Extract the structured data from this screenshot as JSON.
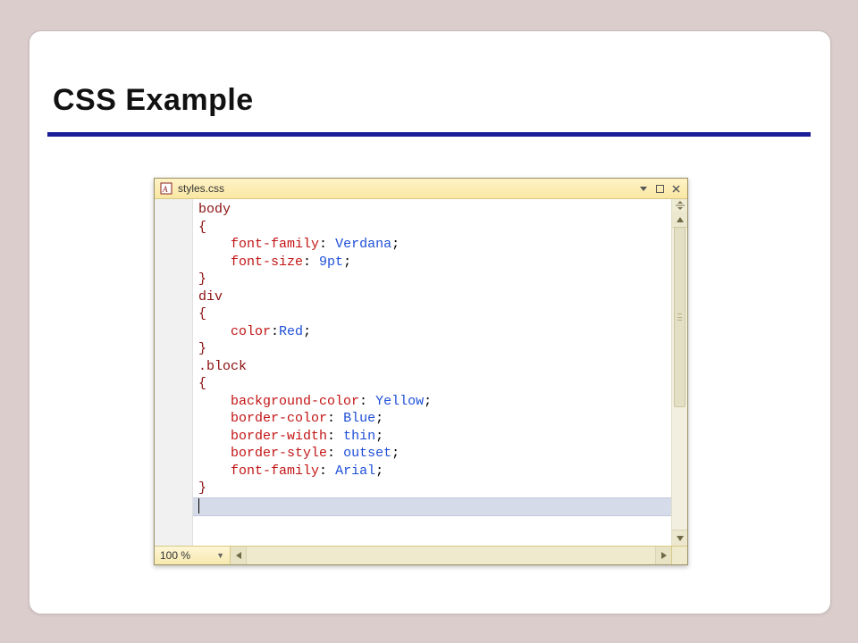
{
  "slide": {
    "title": "CSS Example"
  },
  "editor": {
    "filename": "styles.css",
    "zoom": "100 %",
    "code": {
      "lines": [
        {
          "t": "sel",
          "text": "body"
        },
        {
          "t": "sel",
          "text": "{"
        },
        {
          "t": "decl",
          "indent": "    ",
          "prop": "font-family",
          "sep": ": ",
          "val": "Verdana",
          "end": ";"
        },
        {
          "t": "decl",
          "indent": "    ",
          "prop": "font-size",
          "sep": ": ",
          "val": "9pt",
          "end": ";"
        },
        {
          "t": "sel",
          "text": "}"
        },
        {
          "t": "sel",
          "text": "div"
        },
        {
          "t": "sel",
          "text": "{"
        },
        {
          "t": "decl",
          "indent": "    ",
          "prop": "color",
          "sep": ":",
          "val": "Red",
          "end": ";"
        },
        {
          "t": "sel",
          "text": "}"
        },
        {
          "t": "sel",
          "text": ".block"
        },
        {
          "t": "sel",
          "text": "{"
        },
        {
          "t": "decl",
          "indent": "    ",
          "prop": "background-color",
          "sep": ": ",
          "val": "Yellow",
          "end": ";"
        },
        {
          "t": "decl",
          "indent": "    ",
          "prop": "border-color",
          "sep": ": ",
          "val": "Blue",
          "end": ";"
        },
        {
          "t": "decl",
          "indent": "    ",
          "prop": "border-width",
          "sep": ": ",
          "val": "thin",
          "end": ";"
        },
        {
          "t": "decl",
          "indent": "    ",
          "prop": "border-style",
          "sep": ": ",
          "val": "outset",
          "end": ";"
        },
        {
          "t": "decl",
          "indent": "    ",
          "prop": "font-family",
          "sep": ": ",
          "val": "Arial",
          "end": ";"
        },
        {
          "t": "sel",
          "text": "}"
        }
      ]
    }
  }
}
